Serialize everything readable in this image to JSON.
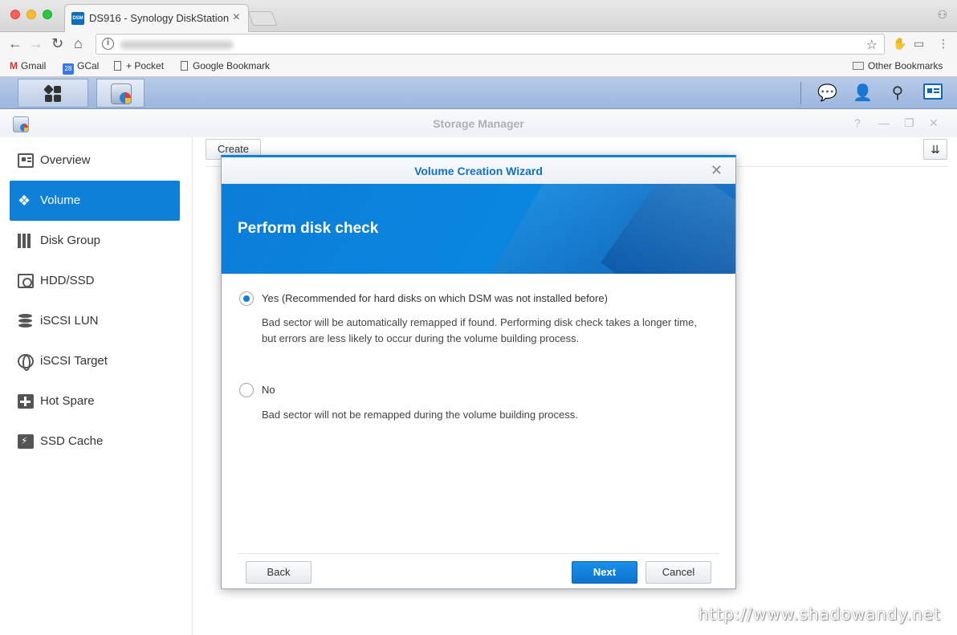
{
  "browser": {
    "tab_title": "DS916 - Synology DiskStation",
    "tab_favicon_text": "DSM",
    "tab_close": "×",
    "bookmarks": {
      "gmail": "Gmail",
      "gcal": "GCal",
      "gcal_badge": "28",
      "pocket": "+ Pocket",
      "google_bookmark": "Google Bookmark",
      "other": "Other Bookmarks"
    }
  },
  "window": {
    "title": "Storage Manager"
  },
  "sidebar": {
    "items": [
      {
        "label": "Overview"
      },
      {
        "label": "Volume"
      },
      {
        "label": "Disk Group"
      },
      {
        "label": "HDD/SSD"
      },
      {
        "label": "iSCSI LUN"
      },
      {
        "label": "iSCSI Target"
      },
      {
        "label": "Hot Spare"
      },
      {
        "label": "SSD Cache"
      }
    ],
    "active_index": 1
  },
  "main": {
    "create_label": "Create"
  },
  "dialog": {
    "title": "Volume Creation Wizard",
    "heading": "Perform disk check",
    "options": [
      {
        "label": "Yes (Recommended for hard disks on which DSM was not installed before)",
        "description": "Bad sector will be automatically remapped if found. Performing disk check takes a longer time, but errors are less likely to occur during the volume building process.",
        "selected": true
      },
      {
        "label": "No",
        "description": "Bad sector will not be remapped during the volume building process.",
        "selected": false
      }
    ],
    "back_label": "Back",
    "next_label": "Next",
    "cancel_label": "Cancel"
  },
  "watermark": "http://www.shadowandy.net",
  "colors": {
    "accent": "#0f80d8",
    "taskbar": "#b7cbe9"
  }
}
